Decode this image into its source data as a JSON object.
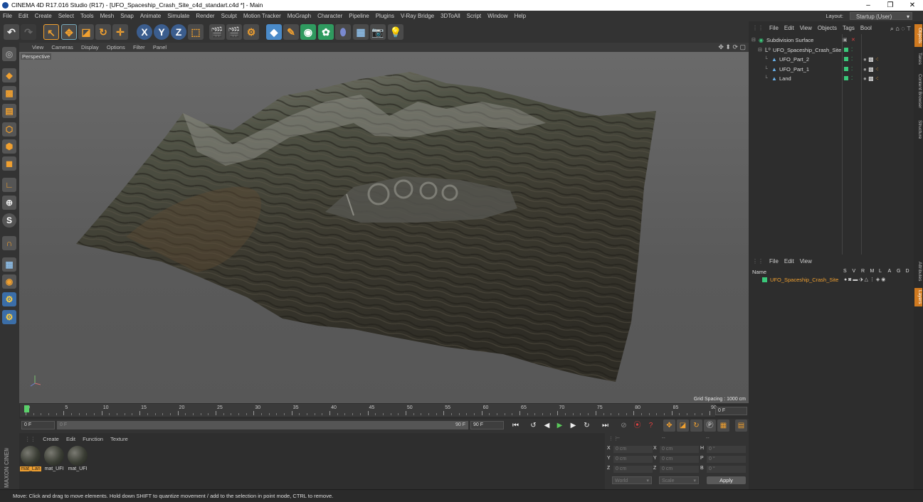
{
  "window": {
    "title": "CINEMA 4D R17.016 Studio (R17) - [UFO_Spaceship_Crash_Site_c4d_standart.c4d *] - Main",
    "minimize": "–",
    "restore": "❐",
    "close": "✕"
  },
  "menubar": {
    "items": [
      "File",
      "Edit",
      "Create",
      "Select",
      "Tools",
      "Mesh",
      "Snap",
      "Animate",
      "Simulate",
      "Render",
      "Sculpt",
      "Motion Tracker",
      "MoGraph",
      "Character",
      "Pipeline",
      "Plugins",
      "V-Ray Bridge",
      "3DToAll",
      "Script",
      "Window",
      "Help"
    ],
    "layout_label": "Layout:",
    "layout_value": "Startup (User)"
  },
  "toolbar": {
    "x_label": "X",
    "y_label": "Y",
    "z_label": "Z"
  },
  "viewport": {
    "menu": [
      "View",
      "Cameras",
      "Display",
      "Options",
      "Filter",
      "Panel"
    ],
    "label": "Perspective",
    "grid_spacing": "Grid Spacing : 1000 cm"
  },
  "timeline": {
    "ticks": [
      "0",
      "5",
      "10",
      "15",
      "20",
      "25",
      "30",
      "35",
      "40",
      "45",
      "50",
      "55",
      "60",
      "65",
      "70",
      "75",
      "80",
      "85",
      "90"
    ],
    "current_frame": "0 F",
    "start_field": "0 F",
    "slider_start": "0 F",
    "slider_end": "90 F",
    "end_field": "90 F"
  },
  "materials": {
    "menu": [
      "Create",
      "Edit",
      "Function",
      "Texture"
    ],
    "items": [
      {
        "label": "mat_Lan",
        "selected": true
      },
      {
        "label": "mat_UFI",
        "selected": false
      },
      {
        "label": "mat_UFI",
        "selected": false
      }
    ]
  },
  "coordinates": {
    "header_dashes": [
      "--",
      "--",
      "--"
    ],
    "rows": [
      {
        "a": "X",
        "av": "0 cm",
        "b": "X",
        "bv": "0 cm",
        "c": "H",
        "cv": "0 °"
      },
      {
        "a": "Y",
        "av": "0 cm",
        "b": "Y",
        "bv": "0 cm",
        "c": "P",
        "cv": "0 °"
      },
      {
        "a": "Z",
        "av": "0 cm",
        "b": "Z",
        "bv": "0 cm",
        "c": "B",
        "cv": "0 °"
      }
    ],
    "mode1": "World",
    "mode2": "Scale",
    "apply": "Apply"
  },
  "object_manager": {
    "menu": [
      "File",
      "Edit",
      "View",
      "Objects",
      "Tags",
      "Bool"
    ],
    "objects": [
      {
        "name": "Subdivision Surface",
        "indent": 0
      },
      {
        "name": "UFO_Spaceship_Crash_Site",
        "indent": 1
      },
      {
        "name": "UFO_Part_2",
        "indent": 2
      },
      {
        "name": "UFO_Part_1",
        "indent": 2
      },
      {
        "name": "Land",
        "indent": 2
      }
    ]
  },
  "layer_manager": {
    "menu": [
      "File",
      "Edit",
      "View"
    ],
    "col_name": "Name",
    "col_flags": [
      "S",
      "V",
      "R",
      "M",
      "L",
      "A",
      "G",
      "D"
    ],
    "layers": [
      {
        "name": "UFO_Spaceship_Crash_Site"
      }
    ]
  },
  "right_tabs": [
    "Objects",
    "Takes",
    "Content Browser",
    "Structure",
    "Attributes",
    "Layers"
  ],
  "status": "Move: Click and drag to move elements. Hold down SHIFT to quantize movement / add to the selection in point mode, CTRL to remove.",
  "branding": "MAXON CINEMA 4D",
  "colors": {
    "accent": "#f0a030",
    "layer_green": "#3ac87a",
    "selected_text": "#f0a030"
  }
}
